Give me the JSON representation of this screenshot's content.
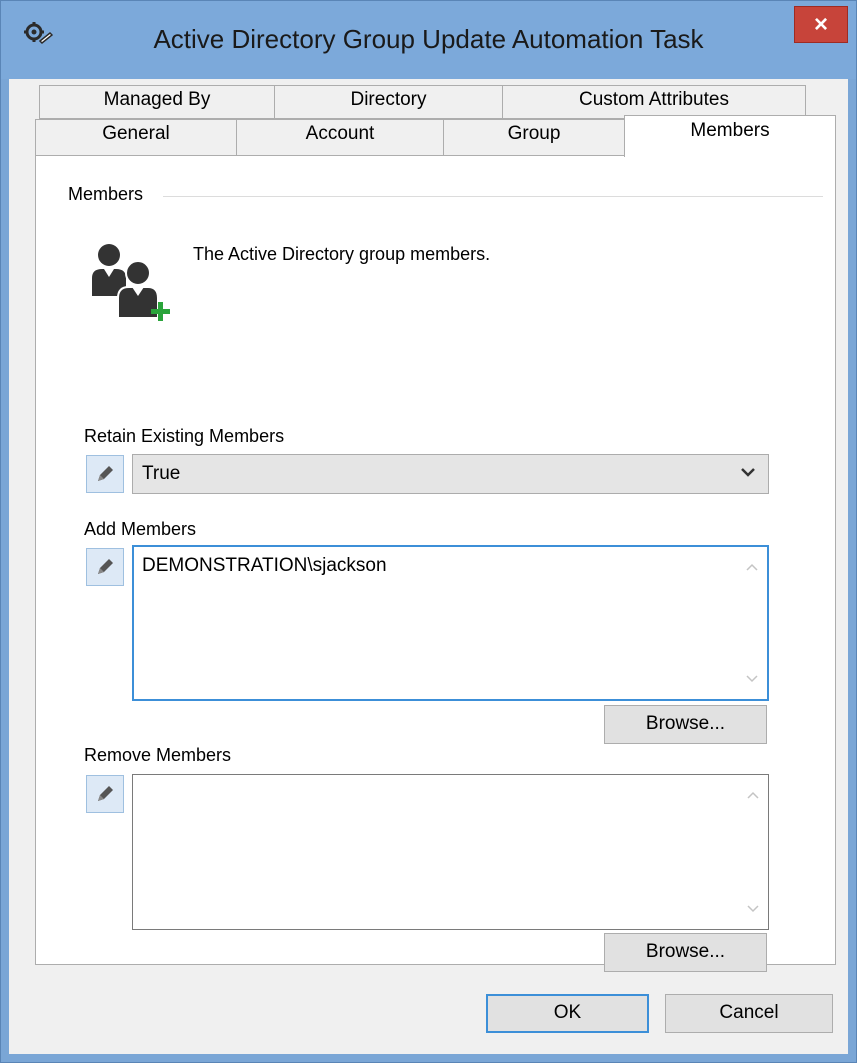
{
  "window": {
    "title": "Active Directory Group Update Automation Task",
    "close_label": "×",
    "app_icon": "settings-gear-icon"
  },
  "tabs": {
    "row1": [
      {
        "label": "Managed By"
      },
      {
        "label": "Directory"
      },
      {
        "label": "Custom Attributes"
      }
    ],
    "row2": [
      {
        "label": "General"
      },
      {
        "label": "Account"
      },
      {
        "label": "Group"
      },
      {
        "label": "Members",
        "active": true
      }
    ]
  },
  "members": {
    "group_title": "Members",
    "icon": "users-add-icon",
    "description": "The Active Directory group members.",
    "retain": {
      "label": "Retain Existing Members",
      "value": "True"
    },
    "add": {
      "label": "Add Members",
      "value": "DEMONSTRATION\\sjackson",
      "browse_label": "Browse..."
    },
    "remove": {
      "label": "Remove Members",
      "value": "",
      "browse_label": "Browse..."
    }
  },
  "footer": {
    "ok_label": "OK",
    "cancel_label": "Cancel"
  },
  "colors": {
    "titlebar": "#7ca9da",
    "close": "#c7443a",
    "focus": "#3c8fd8",
    "add_plus": "#2aa43b"
  }
}
